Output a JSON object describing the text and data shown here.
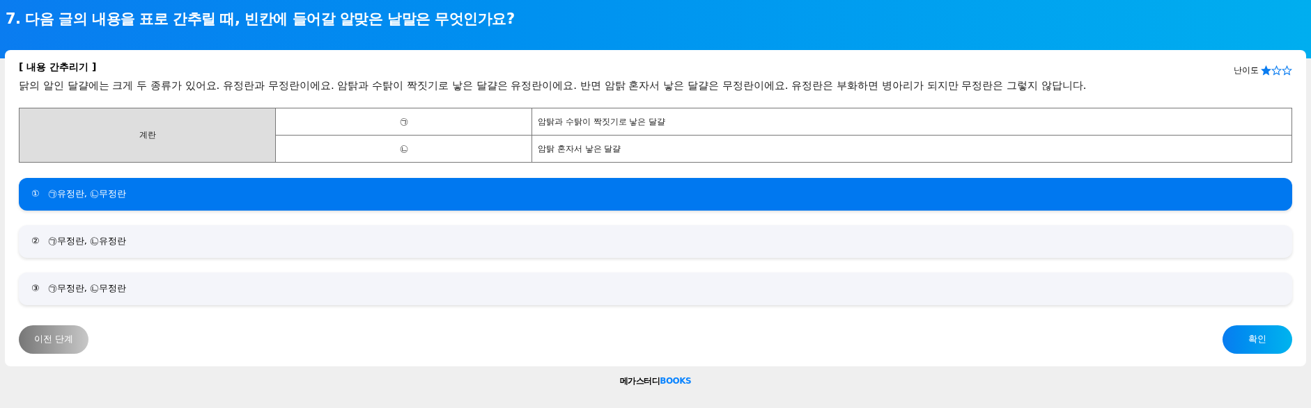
{
  "question": {
    "title": "7. 다음 글의 내용을 표로 간추릴 때, 빈칸에 들어갈 알맞은 낱말은 무엇인가요?"
  },
  "passage": {
    "heading": "[ 내용 간추리기 ]",
    "difficulty_label": "난이도",
    "stars": 1,
    "text": "닭의 알인 달걀에는 크게 두 종류가 있어요. 유정란과 무정란이에요. 암탉과 수탉이 짝짓기로 낳은 달걀은 유정란이에요. 반면 암탉 혼자서 낳은 달걀은 무정란이에요. 유정란은 부화하면 병아리가 되지만 무정란은 그렇지 않답니다."
  },
  "table": {
    "group": "계란",
    "rows": [
      {
        "symbol": "㉠",
        "description": "암탉과 수탉이 짝짓기로 낳은 달걀"
      },
      {
        "symbol": "㉡",
        "description": "암탉 혼자서 낳은 달걀"
      }
    ]
  },
  "options": [
    {
      "number": "①",
      "text": "㉠유정란, ㉡무정란",
      "selected": true
    },
    {
      "number": "②",
      "text": "㉠무정란, ㉡유정란",
      "selected": false
    },
    {
      "number": "③",
      "text": "㉠무정란, ㉡무정란",
      "selected": false
    }
  ],
  "buttons": {
    "previous": "이전 단계",
    "confirm": "확인"
  },
  "footer": {
    "brand": "메가스터디",
    "brand_suffix": "BOOKS"
  }
}
